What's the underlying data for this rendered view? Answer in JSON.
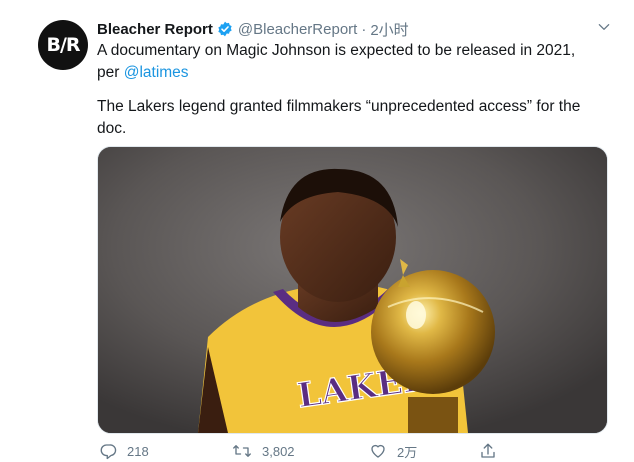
{
  "tweet": {
    "author_name": "Bleacher Report",
    "handle": "@BleacherReport",
    "separator": "·",
    "time": "2小时",
    "avatar_text": "B/R",
    "text_line1": "A documentary on Magic Johnson is expected to be released in 2021,",
    "text_line2_prefix": "per ",
    "mention": "@latimes",
    "text_para2": "The Lakers legend granted filmmakers “unprecedented access” for the doc.",
    "image_jersey_text": "LAKERS"
  },
  "actions": {
    "reply_count": "218",
    "retweet_count": "3,802",
    "like_count": "2万"
  },
  "colors": {
    "link": "#1b95e0",
    "secondary": "#657786",
    "verified": "#1da1f2",
    "jersey": "#f3c53a",
    "trophy": "#c9a32f"
  }
}
